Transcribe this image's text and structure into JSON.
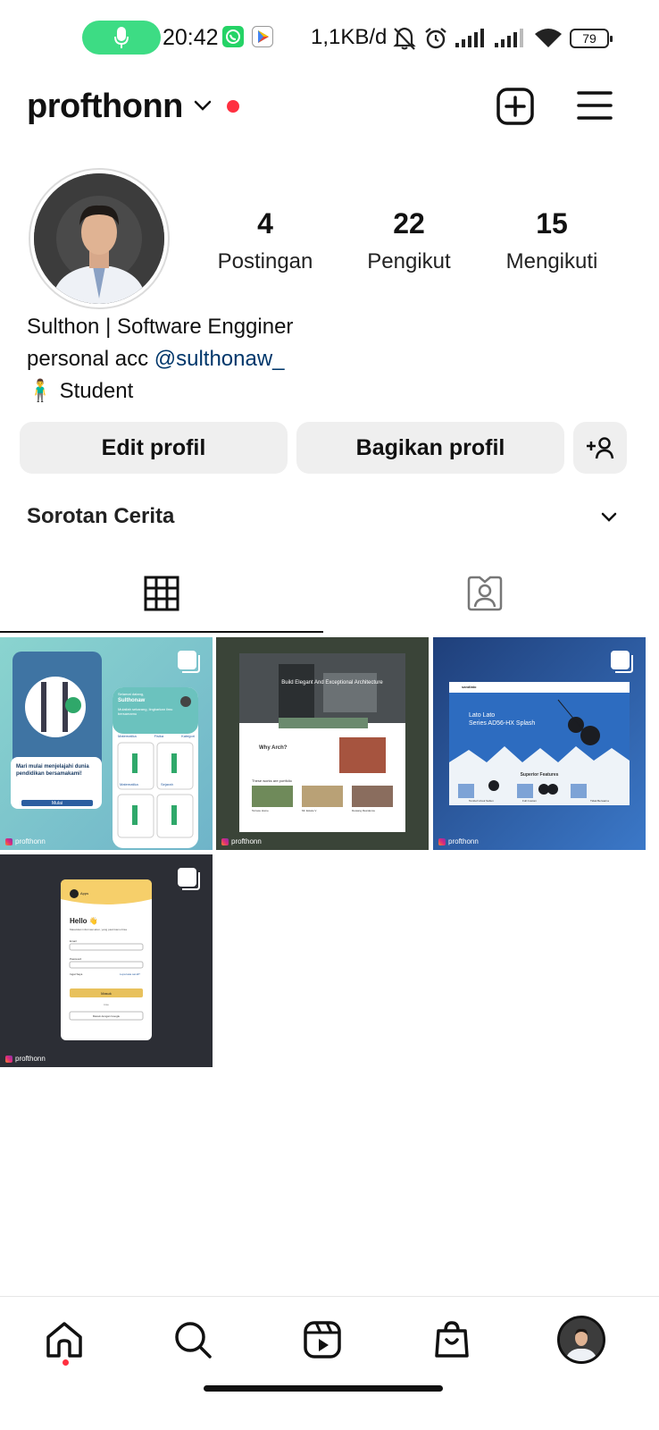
{
  "status_bar": {
    "time": "20:42",
    "network_speed": "1,1KB/d",
    "battery": "79",
    "icons": [
      "mic-icon",
      "whatsapp-icon",
      "play-store-icon",
      "mute-icon",
      "alarm-icon",
      "signal-icon",
      "signal-icon",
      "wifi-icon",
      "battery-icon"
    ],
    "mic_color": "#3ddc84"
  },
  "header": {
    "username": "profthonn",
    "icons": [
      "chevron-down-icon",
      "add-post-icon",
      "menu-icon"
    ],
    "notification_dot_color": "#ff3040"
  },
  "profile": {
    "stats": [
      {
        "value": "4",
        "label": "Postingan"
      },
      {
        "value": "22",
        "label": "Pengikut"
      },
      {
        "value": "15",
        "label": "Mengikuti"
      }
    ],
    "bio": {
      "name": "Sulthon | Software Engginer",
      "line2_prefix": "personal acc ",
      "mention": "@sulthonaw_",
      "line3_emoji": "🧍‍♂️",
      "line3_text": "Student"
    },
    "mention_color": "#00376b"
  },
  "actions": {
    "edit_label": "Edit profil",
    "share_label": "Bagikan profil"
  },
  "highlights": {
    "label": "Sorotan Cerita"
  },
  "tabs": [
    "grid-icon",
    "tagged-icon"
  ],
  "posts": [
    {
      "watermark": "profthonn",
      "thumb": {
        "hero_line1": "Mari mulai menjelajahi dunia",
        "hero_line2": "pendidikan bersamakami!",
        "hero_button": "Mulai",
        "card_greeting": "Selamat datang,",
        "card_name": "Sulthonaw",
        "card_subtitle": "Mulailah sekarang, lingkarkan ilmu bersamamu",
        "tabs": [
          "Matematika",
          "Fisika",
          "Kategori"
        ],
        "items": [
          "Matematika",
          "Sejarah"
        ]
      }
    },
    {
      "watermark": "profthonn",
      "thumb": {
        "hero_title": "Build Elegant And Exceptional Architecture",
        "section_title": "Why Arch?",
        "list_title": "These works are portfolio",
        "projects": [
          "Terrace Home",
          "Mt. Estate V",
          "Dewang Residence"
        ]
      }
    },
    {
      "watermark": "profthonn",
      "thumb": {
        "brand": "sandlato",
        "hero_line1": "Lato Lato",
        "hero_line2": "Series AD56-HX Splash",
        "features_title": "Superior Features",
        "features": [
          "Tombol Untuk Sabun",
          "Full Custom",
          "Tidak Berwarna"
        ]
      }
    },
    {
      "watermark": "profthonn",
      "thumb": {
        "brand": "Apps",
        "greeting": "Hello 👋",
        "subtitle": "Masukkan informasi akun, yang pasti kamu bisa",
        "email_label": "Email",
        "password_label": "Password",
        "remember": "Ingat Saya",
        "forgot": "Lupa kata sandi?",
        "login_button": "Masuk",
        "or_text": "Atau",
        "google_button": "Masuk dengan Google"
      }
    }
  ],
  "bottom_nav": [
    "home-icon",
    "search-icon",
    "reels-icon",
    "shop-icon",
    "profile-avatar"
  ],
  "colors": {
    "button_bg": "#efefef",
    "accent_red": "#ff3040",
    "post1_bg": "#7cc7c4",
    "post2_bg": "#3a4438",
    "post3_bg": "#2a62b0",
    "post4_bg": "#2c2e35"
  }
}
